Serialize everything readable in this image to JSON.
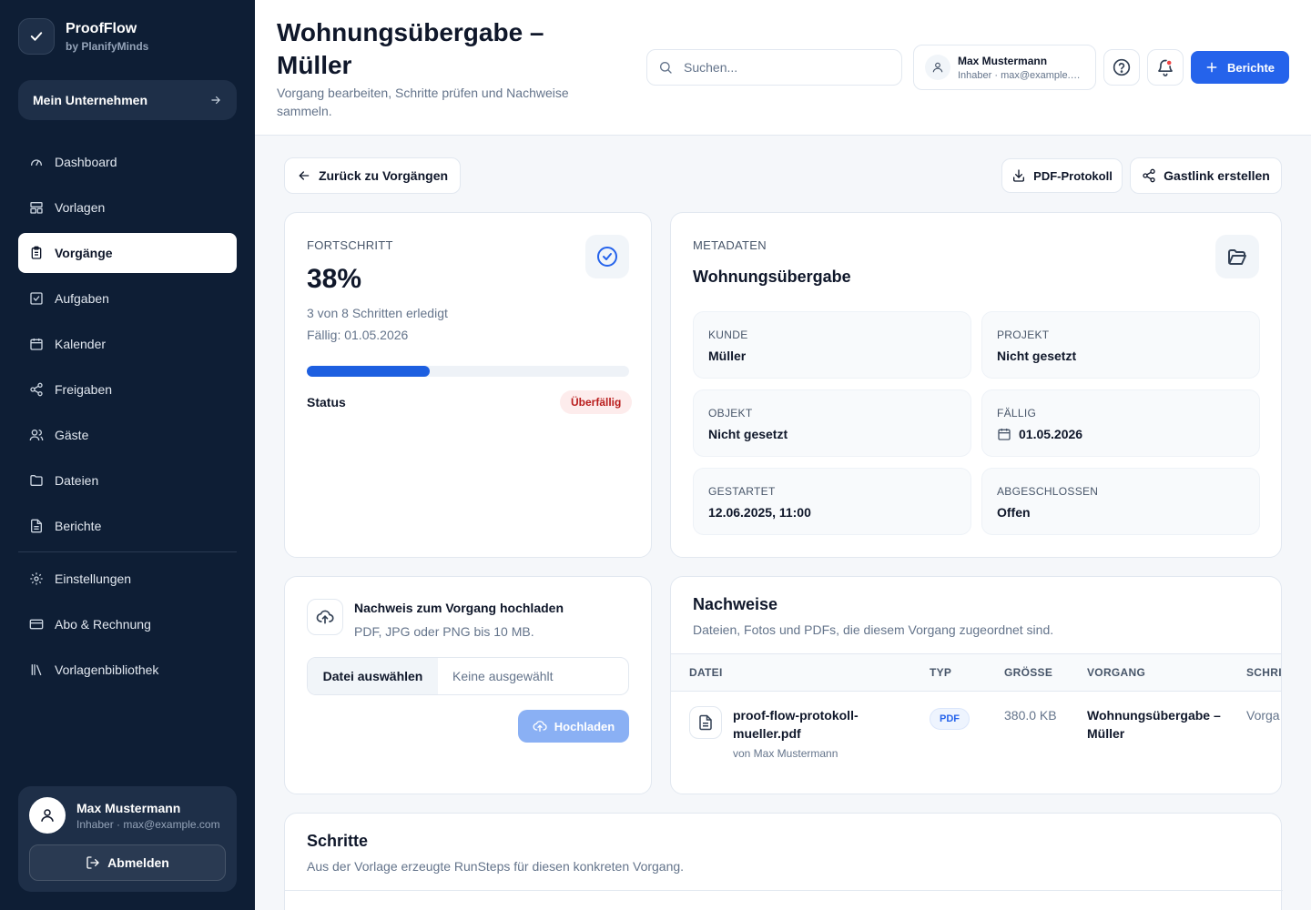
{
  "brand": {
    "name": "ProofFlow",
    "sub": "by PlanifyMinds",
    "company": "Mein Unternehmen"
  },
  "sidebar": {
    "items": [
      {
        "label": "Dashboard",
        "icon": "gauge-icon"
      },
      {
        "label": "Vorlagen",
        "icon": "layout-icon"
      },
      {
        "label": "Vorgänge",
        "icon": "clipboard-icon",
        "active": true
      },
      {
        "label": "Aufgaben",
        "icon": "check-square-icon"
      },
      {
        "label": "Kalender",
        "icon": "calendar-icon"
      },
      {
        "label": "Freigaben",
        "icon": "share-icon"
      },
      {
        "label": "Gäste",
        "icon": "users-icon"
      },
      {
        "label": "Dateien",
        "icon": "folder-icon"
      },
      {
        "label": "Berichte",
        "icon": "file-text-icon"
      }
    ],
    "bottom_items": [
      {
        "label": "Einstellungen",
        "icon": "gear-icon"
      },
      {
        "label": "Abo & Rechnung",
        "icon": "credit-card-icon"
      },
      {
        "label": "Vorlagenbibliothek",
        "icon": "library-icon"
      }
    ],
    "user": {
      "name": "Max Mustermann",
      "sub": "Inhaber · max@example.com",
      "logout": "Abmelden"
    }
  },
  "header": {
    "title": "Wohnungsübergabe – Müller",
    "subtitle": "Vorgang bearbeiten, Schritte prüfen und Nachweise sammeln.",
    "search_placeholder": "Suchen...",
    "user_name": "Max Mustermann",
    "user_sub": "Inhaber · max@example.com",
    "reports_button": "Berichte"
  },
  "actions": {
    "back": "Zurück zu Vorgängen",
    "pdf": "PDF-Protokoll",
    "guestlink": "Gastlink erstellen"
  },
  "progress": {
    "caption": "FORTSCHRITT",
    "percent_label": "38%",
    "percent": 38,
    "steps_text": "3 von 8 Schritten erledigt",
    "due_text": "Fällig: 01.05.2026",
    "status_label": "Status",
    "status_badge": "Überfällig"
  },
  "metadata": {
    "caption": "METADATEN",
    "title": "Wohnungsübergabe",
    "fields": [
      {
        "label": "KUNDE",
        "value": "Müller"
      },
      {
        "label": "PROJEKT",
        "value": "Nicht gesetzt"
      },
      {
        "label": "OBJEKT",
        "value": "Nicht gesetzt"
      },
      {
        "label": "FÄLLIG",
        "value": "01.05.2026"
      },
      {
        "label": "GESTARTET",
        "value": "12.06.2025, 11:00"
      },
      {
        "label": "ABGESCHLOSSEN",
        "value": "Offen"
      }
    ]
  },
  "upload": {
    "title": "Nachweis zum Vorgang hochladen",
    "hint": "PDF, JPG oder PNG bis 10 MB.",
    "choose": "Datei auswählen",
    "none": "Keine ausgewählt",
    "button": "Hochladen"
  },
  "evidence": {
    "title": "Nachweise",
    "subtitle": "Dateien, Fotos und PDFs, die diesem Vorgang zugeordnet sind.",
    "columns": [
      "DATEI",
      "TYP",
      "GRÖSSE",
      "VORGANG",
      "SCHRI"
    ],
    "rows": [
      {
        "file": "proof-flow-protokoll-mueller.pdf",
        "uploader": "von Max Mustermann",
        "type": "PDF",
        "size": "380.0 KB",
        "process": "Wohnungsübergabe – Müller",
        "step": "Vorga"
      }
    ]
  },
  "steps": {
    "title": "Schritte",
    "subtitle": "Aus der Vorlage erzeugte RunSteps für diesen konkreten Vorgang."
  },
  "colors": {
    "sidebar": "#0e1e35",
    "accent": "#2563eb",
    "danger": "#b91c1c"
  }
}
